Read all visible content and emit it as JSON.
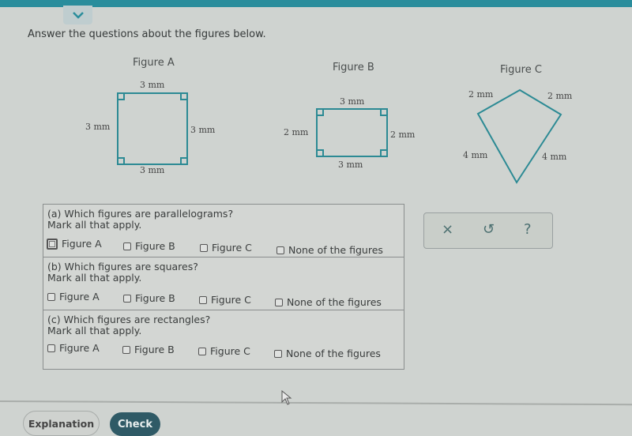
{
  "header": {
    "collapse_icon": "chevron-down-icon",
    "accent_color": "#2a8d9c"
  },
  "instructions": "Answer the questions about the figures below.",
  "figures": [
    {
      "label": "Figure A",
      "top": "3 mm",
      "bottom": "3 mm",
      "left": "3 mm",
      "right": "3 mm"
    },
    {
      "label": "Figure B",
      "top": "3 mm",
      "bottom": "3 mm",
      "left": "2 mm",
      "right": "2 mm"
    },
    {
      "label": "Figure C",
      "upper_left": "2 mm",
      "upper_right": "2 mm",
      "lower_left": "4 mm",
      "lower_right": "4 mm"
    }
  ],
  "questions": [
    {
      "prompt": "(a) Which figures are parallelograms?",
      "hint": "Mark all that apply.",
      "options": [
        "Figure A",
        "Figure B",
        "Figure C",
        "None of the figures"
      ]
    },
    {
      "prompt": "(b) Which figures are squares?",
      "hint": "Mark all that apply.",
      "options": [
        "Figure A",
        "Figure B",
        "Figure C",
        "None of the figures"
      ]
    },
    {
      "prompt": "(c) Which figures are rectangles?",
      "hint": "Mark all that apply.",
      "options": [
        "Figure A",
        "Figure B",
        "Figure C",
        "None of the figures"
      ]
    }
  ],
  "tools": {
    "clear": "×",
    "undo": "↺",
    "help": "?"
  },
  "footer": {
    "explanation_label": "Explanation",
    "check_label": "Check",
    "check_color": "#2f5a66"
  }
}
